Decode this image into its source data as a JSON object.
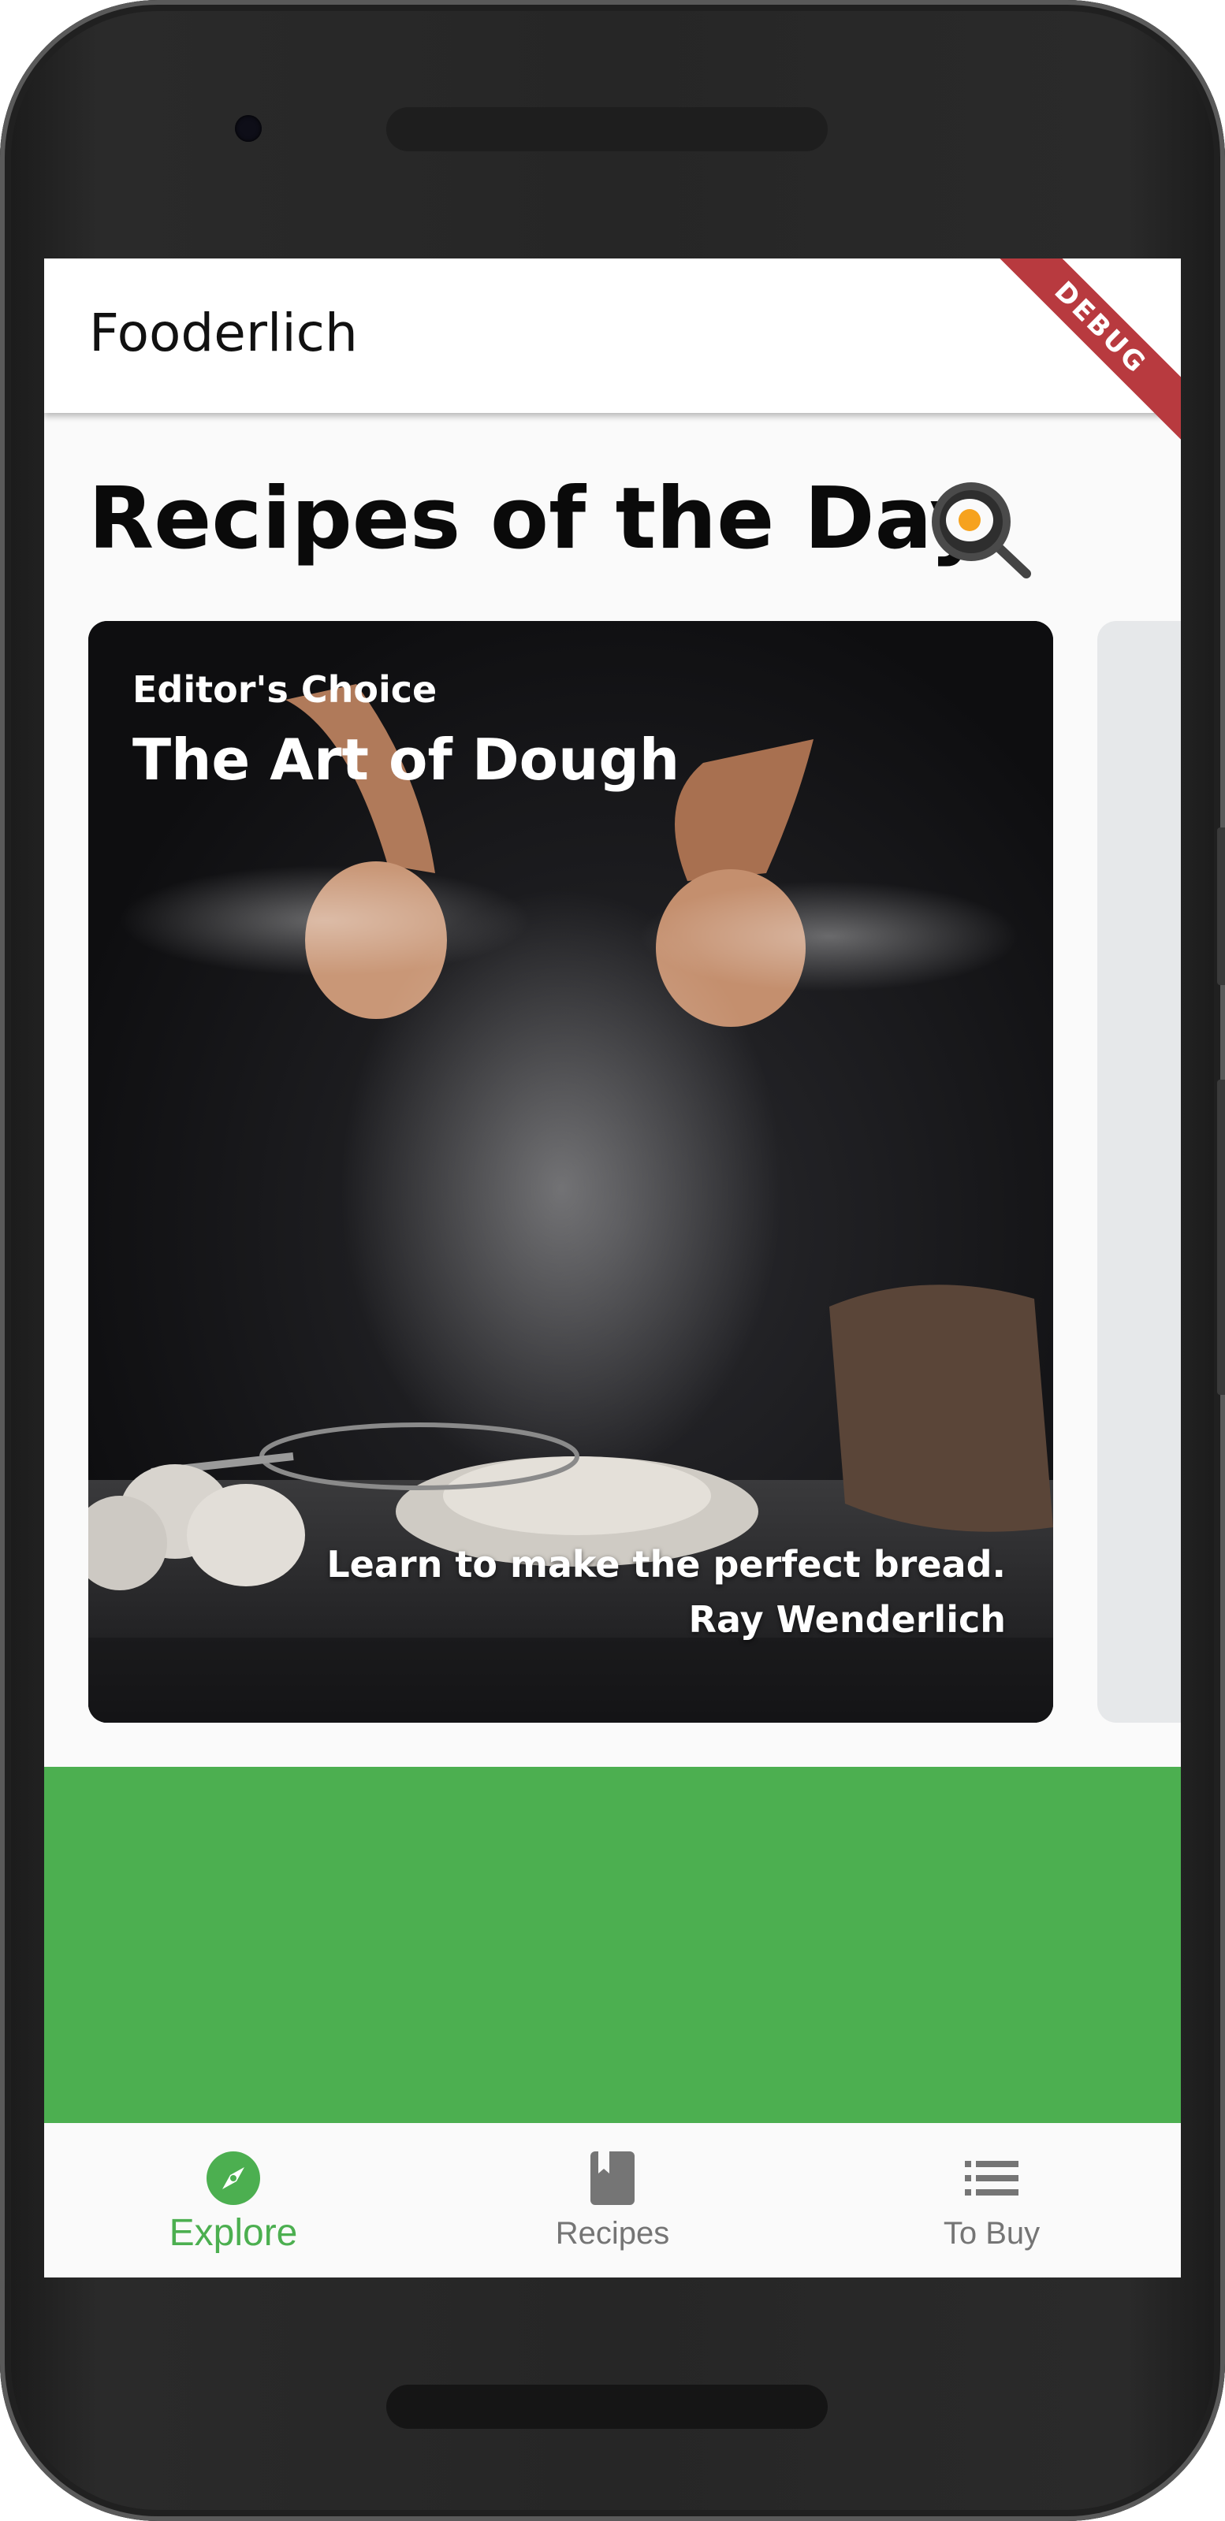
{
  "app": {
    "title": "Fooderlich",
    "debug_banner": "DEBUG"
  },
  "explore": {
    "section_title": "Recipes of the Day",
    "section_icon": "frying-pan-egg-icon",
    "featured_card": {
      "subtitle": "Editor's Choice",
      "title": "The Art of Dough",
      "description": "Learn to make the perfect bread.",
      "author": "Ray Wenderlich",
      "image": "flour-dusting-hands-photo"
    }
  },
  "bottom_nav": {
    "items": [
      {
        "label": "Explore",
        "icon": "compass-icon",
        "selected": true
      },
      {
        "label": "Recipes",
        "icon": "book-icon",
        "selected": false
      },
      {
        "label": "To Buy",
        "icon": "list-icon",
        "selected": false
      }
    ]
  },
  "colors": {
    "accent_green": "#4caf50",
    "selected_nav": "#4caf50",
    "unselected_nav": "#757575",
    "debug_banner": "#b83a3f",
    "app_bar": "#ffffff"
  }
}
